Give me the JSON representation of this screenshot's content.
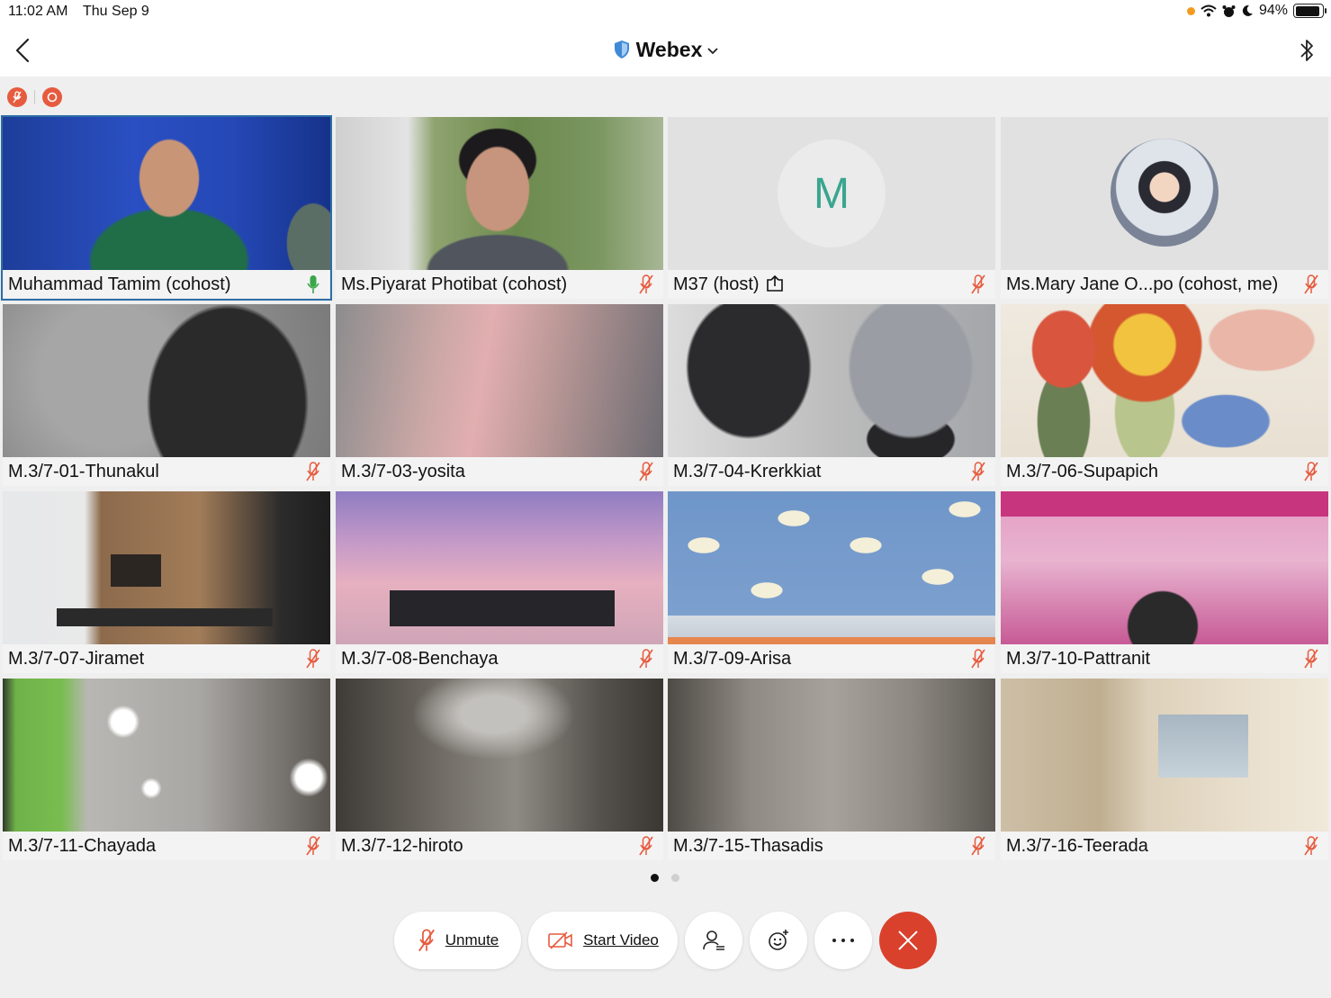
{
  "status_bar": {
    "time": "11:02 AM",
    "date": "Thu Sep 9",
    "battery": "94%",
    "icons": [
      "wifi-icon",
      "alarm-icon",
      "moon-icon",
      "battery-icon"
    ]
  },
  "nav": {
    "title": "Webex",
    "icons": [
      "back-chevron-icon",
      "shield-icon",
      "chevron-down-icon",
      "bluetooth-icon"
    ]
  },
  "participants": [
    {
      "name": "Muhammad Tamim (cohost)",
      "mic": "on",
      "active": true
    },
    {
      "name": "Ms.Piyarat Photibat (cohost)",
      "mic": "muted"
    },
    {
      "name": "M37 (host)",
      "mic": "muted",
      "avatar_letter": "M",
      "sharing": true
    },
    {
      "name": "Ms.Mary Jane O...po (cohost, me)",
      "mic": "muted",
      "avatar_photo": true
    },
    {
      "name": "M.3/7-01-Thunakul",
      "mic": "muted"
    },
    {
      "name": "M.3/7-03-yosita",
      "mic": "muted"
    },
    {
      "name": "M.3/7-04-Krerkkiat",
      "mic": "muted"
    },
    {
      "name": "M.3/7-06-Supapich",
      "mic": "muted"
    },
    {
      "name": "M.3/7-07-Jiramet",
      "mic": "muted"
    },
    {
      "name": "M.3/7-08-Benchaya",
      "mic": "muted"
    },
    {
      "name": "M.3/7-09-Arisa",
      "mic": "muted"
    },
    {
      "name": "M.3/7-10-Pattranit",
      "mic": "muted"
    },
    {
      "name": "M.3/7-11-Chayada",
      "mic": "muted"
    },
    {
      "name": "M.3/7-12-hiroto",
      "mic": "muted"
    },
    {
      "name": "M.3/7-15-Thasadis",
      "mic": "muted"
    },
    {
      "name": "M.3/7-16-Teerada",
      "mic": "muted"
    }
  ],
  "pagination": {
    "pages": 2,
    "current": 1
  },
  "controls": {
    "unmute_label": "Unmute",
    "start_video_label": "Start Video",
    "icons": [
      "participants-icon",
      "reactions-icon",
      "more-icon",
      "end-call-icon"
    ]
  },
  "colors": {
    "accent": "#2d6ea5",
    "muted_red": "#e65b3f",
    "end_call": "#d9412d",
    "avatar_letter": "#3aa58f",
    "mic_on_green": "#3aa64a"
  }
}
